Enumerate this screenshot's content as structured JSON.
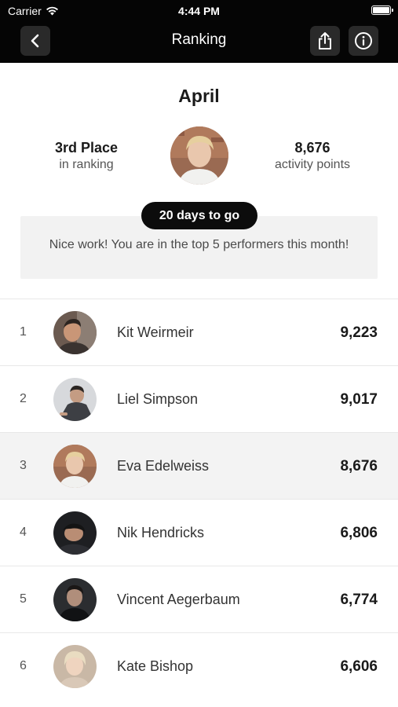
{
  "status_bar": {
    "carrier": "Carrier",
    "time": "4:44 PM",
    "icons": [
      "wifi-icon",
      "battery-icon"
    ]
  },
  "nav": {
    "title": "Ranking",
    "icons": [
      "back-chevron-icon",
      "share-icon",
      "info-icon"
    ]
  },
  "header": {
    "month": "April",
    "place": "3rd Place",
    "place_sub": "in ranking",
    "points": "8,676",
    "points_sub": "activity points"
  },
  "countdown": "20 days to go",
  "banner_text": "Nice work! You are in the top 5 performers this month!",
  "colors": {
    "top_bar": "#050505",
    "highlight_row": "#f3f3f3",
    "banner_bg": "#f2f2f2"
  },
  "ranking": [
    {
      "rank": "1",
      "name": "Kit Weirmeir",
      "points": "9,223"
    },
    {
      "rank": "2",
      "name": "Liel Simpson",
      "points": "9,017"
    },
    {
      "rank": "3",
      "name": "Eva Edelweiss",
      "points": "8,676",
      "highlight": true
    },
    {
      "rank": "4",
      "name": "Nik Hendricks",
      "points": "6,806"
    },
    {
      "rank": "5",
      "name": "Vincent Aegerbaum",
      "points": "6,774"
    },
    {
      "rank": "6",
      "name": "Kate Bishop",
      "points": "6,606"
    }
  ]
}
